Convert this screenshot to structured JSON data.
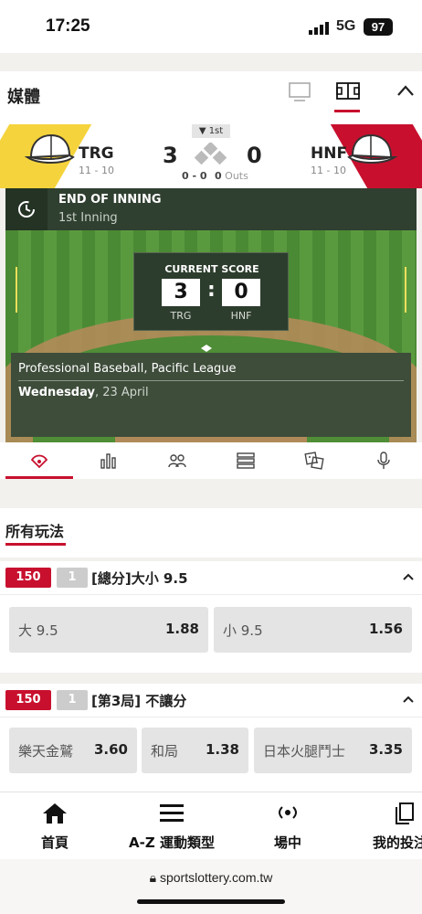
{
  "status_bar": {
    "time": "17:25",
    "network": "5G",
    "battery": "97"
  },
  "media": {
    "title": "媒體"
  },
  "scoreboard": {
    "inning": "1st",
    "home": {
      "name": "TRG",
      "record": "11 - 10",
      "score": "3"
    },
    "away": {
      "name": "HNF",
      "record": "11 - 10",
      "score": "0"
    },
    "count": "0 - 0",
    "outs_value": "0",
    "outs_label": "Outs",
    "colors": {
      "home_stripe": "#f5d33c",
      "away_stripe": "#c8102e"
    }
  },
  "field": {
    "inning_status": "END OF INNING",
    "inning_sub": "1st Inning",
    "current_score_label": "CURRENT SCORE",
    "score_home": "3",
    "score_away": "0",
    "team_home": "TRG",
    "team_away": "HNF",
    "league": "Professional Baseball, Pacific League",
    "day": "Wednesday",
    "date": ", 23 April"
  },
  "tabs": [
    {
      "icon": "baseball-field-icon"
    },
    {
      "icon": "stats-bar-icon"
    },
    {
      "icon": "lineup-icon"
    },
    {
      "icon": "list-icon"
    },
    {
      "icon": "dice-icon"
    },
    {
      "icon": "microphone-icon"
    }
  ],
  "all_bets": {
    "title": "所有玩法"
  },
  "markets": [
    {
      "code": "150",
      "num": "1",
      "title": "[總分]大小 9.5",
      "options": [
        {
          "label": "大 9.5",
          "odds": "1.88"
        },
        {
          "label": "小 9.5",
          "odds": "1.56"
        }
      ]
    },
    {
      "code": "150",
      "num": "1",
      "title": "[第3局] 不讓分",
      "options": [
        {
          "label": "樂天金鷲",
          "odds": "3.60"
        },
        {
          "label": "和局",
          "odds": "1.38"
        },
        {
          "label": "日本火腿鬥士",
          "odds": "3.35"
        }
      ]
    }
  ],
  "bottom_nav": [
    {
      "label": "首頁",
      "icon": "home-icon"
    },
    {
      "label": "A-Z 運動類型",
      "icon": "menu-icon"
    },
    {
      "label": "場中",
      "icon": "live-icon"
    },
    {
      "label": "我的投注",
      "icon": "my-bets-icon"
    }
  ],
  "url": "sportslottery.com.tw",
  "accent": "#c8102e"
}
